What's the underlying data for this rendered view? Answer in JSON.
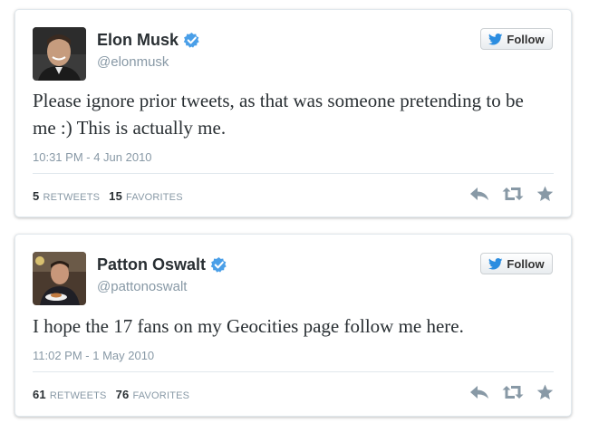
{
  "tweets": [
    {
      "name": "Elon Musk",
      "handle": "@elonmusk",
      "follow_label": "Follow",
      "text": "Please ignore prior tweets, as that was someone pretending to be me :)  This is actually me.",
      "timestamp": "10:31 PM - 4 Jun 2010",
      "retweets": "5",
      "retweets_label": "RETWEETS",
      "favorites": "15",
      "favorites_label": "FAVORITES"
    },
    {
      "name": "Patton Oswalt",
      "handle": "@pattonoswalt",
      "follow_label": "Follow",
      "text": "I hope the 17 fans on my Geocities page follow me here.",
      "timestamp": "11:02 PM - 1 May 2010",
      "retweets": "61",
      "retweets_label": "RETWEETS",
      "favorites": "76",
      "favorites_label": "FAVORITES"
    }
  ],
  "colors": {
    "verified": "#4a9fe8",
    "twitter_bird": "#2b8de0",
    "action_icon": "#8899a6"
  },
  "icons": {
    "verified": "verified-badge-icon",
    "follow": "twitter-bird-icon",
    "reply": "reply-icon",
    "retweet": "retweet-icon",
    "favorite": "star-icon"
  }
}
